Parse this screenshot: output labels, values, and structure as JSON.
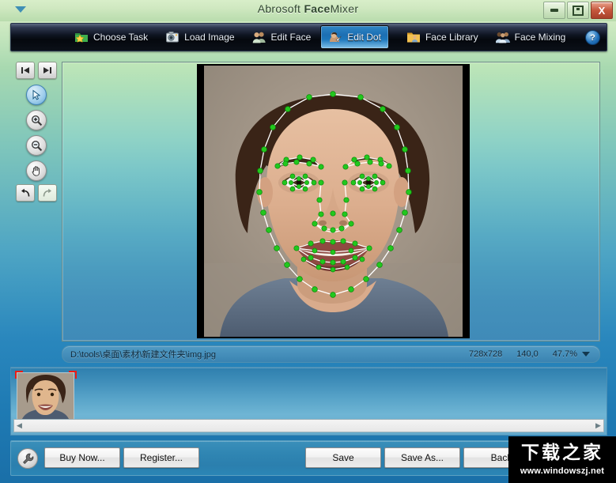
{
  "window": {
    "title_prefix": "Abrosoft ",
    "title_bold": "Face",
    "title_suffix": "Mixer",
    "sysmenu_icon": "chevron-down-icon",
    "minimize_label": "Minimize",
    "maximize_label": "Maximize",
    "close_label": "X"
  },
  "toolbar": {
    "tabs": [
      {
        "label": "Choose Task",
        "icon": "folder-star-icon",
        "active": false
      },
      {
        "label": "Load Image",
        "icon": "camera-icon",
        "active": false
      },
      {
        "label": "Edit Face",
        "icon": "two-people-icon",
        "active": false
      },
      {
        "label": "Edit Dot",
        "icon": "face-pointer-icon",
        "active": true
      },
      {
        "label": "Face Library",
        "icon": "folder-person-icon",
        "active": false
      },
      {
        "label": "Face Mixing",
        "icon": "three-people-icon",
        "active": false
      }
    ],
    "help_label": "?"
  },
  "tools": [
    {
      "name": "first-frame-button",
      "icon": "skip-back-icon",
      "selected": false
    },
    {
      "name": "last-frame-button",
      "icon": "skip-forward-icon",
      "selected": false
    },
    {
      "name": "select-tool",
      "icon": "arrow-cursor-icon",
      "selected": true
    },
    {
      "name": "zoom-in-tool",
      "icon": "magnifier-plus-icon",
      "selected": false
    },
    {
      "name": "zoom-out-tool",
      "icon": "magnifier-minus-icon",
      "selected": false
    },
    {
      "name": "pan-tool",
      "icon": "hand-icon",
      "selected": false
    },
    {
      "name": "undo-button",
      "icon": "undo-arrow-icon",
      "selected": false
    },
    {
      "name": "redo-button",
      "icon": "redo-arrow-icon",
      "selected": false
    }
  ],
  "status": {
    "file_path": "D:\\tools\\桌面\\素材\\新建文件夹\\img.jpg",
    "dimensions": "728x728",
    "coordinates": "140,0",
    "zoom_level": "47.7%",
    "zoom_caret_icon": "chevron-down-icon"
  },
  "thumbnails": {
    "selected_index": 0,
    "items": [
      {
        "name": "face-thumbnail-1",
        "selected": true
      }
    ],
    "scroll_left_icon": "triangle-left-icon",
    "scroll_right_icon": "triangle-right-icon"
  },
  "bottom": {
    "settings_icon": "wrench-icon",
    "buy_label": "Buy Now...",
    "register_label": "Register...",
    "save_label": "Save",
    "save_as_label": "Save As...",
    "back_label": "Back"
  },
  "watermark": {
    "text_cn": "下载之家",
    "url": "www.windowszj.net"
  },
  "colors": {
    "accent_blue": "#1d77bb",
    "dot_green": "#22c81e",
    "outline_white": "#ffffff",
    "close_red": "#c5573c",
    "marker_red": "#ee1c13"
  }
}
